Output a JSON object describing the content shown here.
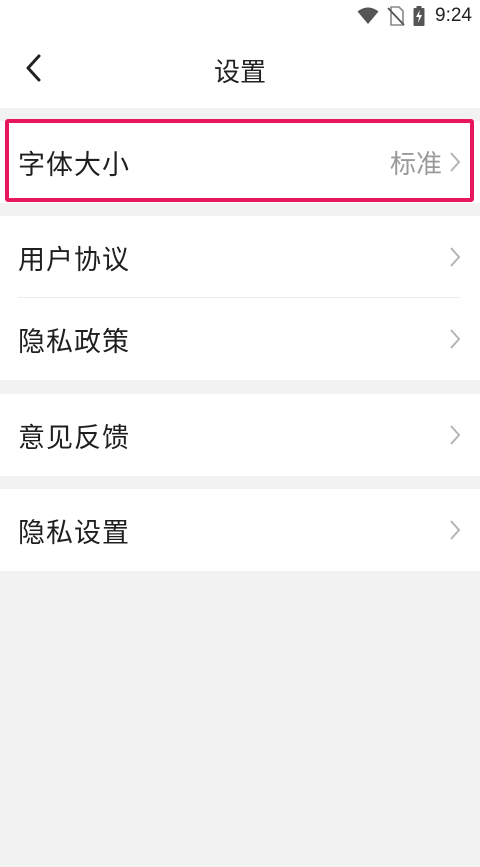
{
  "status_bar": {
    "time": "9:24",
    "icons": [
      "wifi-icon",
      "no-sim-icon",
      "battery-charging-icon"
    ]
  },
  "header": {
    "title": "设置",
    "back_icon": "chevron-left-icon"
  },
  "settings": {
    "font_size": {
      "label": "字体大小",
      "value": "标准"
    },
    "user_agreement": {
      "label": "用户协议"
    },
    "privacy_policy": {
      "label": "隐私政策"
    },
    "feedback": {
      "label": "意见反馈"
    },
    "privacy_settings": {
      "label": "隐私设置"
    }
  },
  "colors": {
    "highlight": "#e8175d",
    "background": "#f2f2f2",
    "row_background": "#ffffff"
  }
}
